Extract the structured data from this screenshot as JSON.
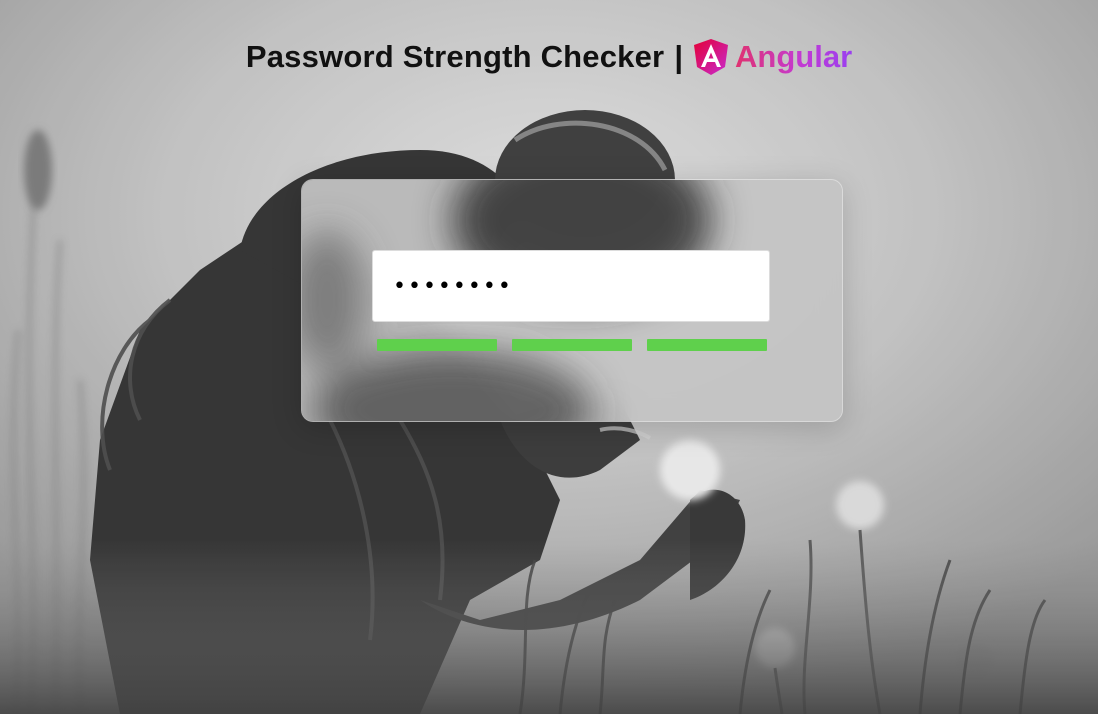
{
  "header": {
    "title": "Password Strength Checker",
    "separator": "|",
    "brand_name": "Angular",
    "brand_icon": "angular-icon"
  },
  "password_field": {
    "value": "••••••••",
    "type": "password",
    "placeholder": ""
  },
  "strength_meter": {
    "segments_filled": 3,
    "segments_total": 3,
    "filled_color": "#5fd04c",
    "empty_color": "#dddddd"
  },
  "colors": {
    "angular_gradient_start": "#e0326f",
    "angular_gradient_end": "#9a3ff0"
  }
}
